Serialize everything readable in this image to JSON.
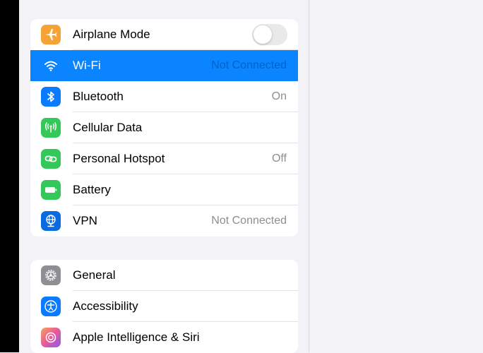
{
  "network_group": [
    {
      "label": "Airplane Mode",
      "icon": "airplane-icon",
      "color": "#f7a234",
      "value": "",
      "toggle": false
    },
    {
      "label": "Wi-Fi",
      "icon": "wifi-icon",
      "color": "#0a84ff",
      "value": "Not Connected",
      "selected": true
    },
    {
      "label": "Bluetooth",
      "icon": "bluetooth-icon",
      "color": "#0a7aff",
      "value": "On"
    },
    {
      "label": "Cellular Data",
      "icon": "cellular-icon",
      "color": "#34c759",
      "value": ""
    },
    {
      "label": "Personal Hotspot",
      "icon": "hotspot-icon",
      "color": "#34c759",
      "value": "Off"
    },
    {
      "label": "Battery",
      "icon": "battery-icon",
      "color": "#34c759",
      "value": ""
    },
    {
      "label": "VPN",
      "icon": "vpn-globe-icon",
      "color": "#0a6adf",
      "value": "Not Connected"
    }
  ],
  "general_group": [
    {
      "label": "General",
      "icon": "gear-icon",
      "color": "#8e8e93"
    },
    {
      "label": "Accessibility",
      "icon": "accessibility-icon",
      "color": "#0a7aff"
    },
    {
      "label": "Apple Intelligence & Siri",
      "icon": "siri-icon",
      "color": "#d957a6"
    }
  ],
  "colors": {
    "selected_row": "#0a84ff",
    "background": "#f2f2f7"
  }
}
